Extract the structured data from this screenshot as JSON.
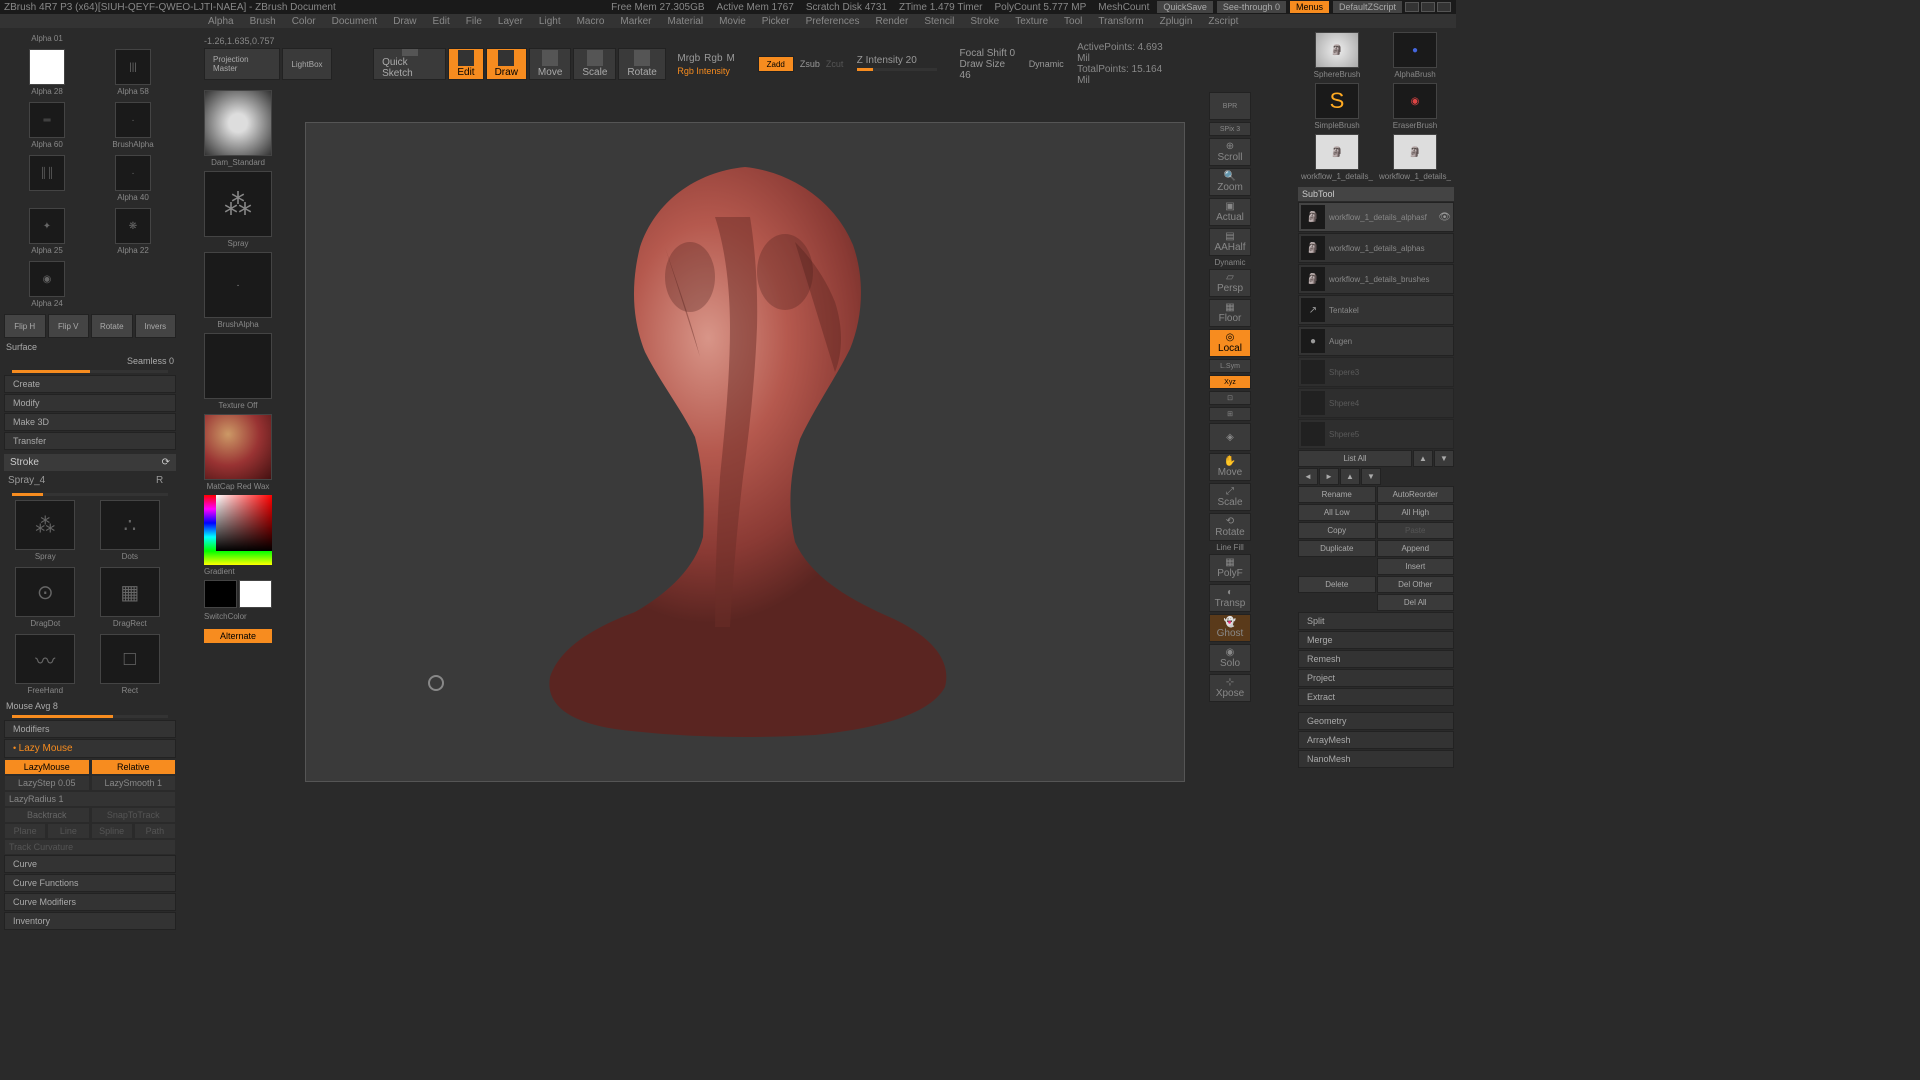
{
  "title": "ZBrush 4R7 P3 (x64)[SIUH-QEYF-QWEO-LJTI-NAEA]  -  ZBrush Document",
  "stats": {
    "freemem": "Free Mem 27.305GB",
    "activemem": "Active Mem 1767",
    "scratch": "Scratch Disk 4731",
    "ztime": "ZTime 1.479 Timer",
    "polycount": "PolyCount 5.777 MP",
    "meshcount": "MeshCount"
  },
  "quicksave": "QuickSave",
  "seethrough": "See-through  0",
  "menus": "Menus",
  "defaultscript": "DefaultZScript",
  "menu": [
    "Alpha",
    "Brush",
    "Color",
    "Document",
    "Draw",
    "Edit",
    "File",
    "Layer",
    "Light",
    "Macro",
    "Marker",
    "Material",
    "Movie",
    "Picker",
    "Preferences",
    "Render",
    "Stencil",
    "Stroke",
    "Texture",
    "Tool",
    "Transform",
    "Zplugin",
    "Zscript"
  ],
  "coords": "-1.26,1.635,0.757",
  "alphas": [
    [
      "Alpha 28",
      "Alpha 58"
    ],
    [
      "Alpha 60",
      "BrushAlpha"
    ],
    [
      "Alpha 25",
      "Alpha 22"
    ],
    [
      "Alpha 24",
      ""
    ]
  ],
  "alpha_top": [
    "Alpha 01",
    ""
  ],
  "alpha40": "Alpha 40",
  "flip": [
    "Flip H",
    "Flip V",
    "Rotate",
    "Invers"
  ],
  "surface": "Surface",
  "seamless": "Seamless 0",
  "create": "Create",
  "modify": "Modify",
  "make3d": "Make 3D",
  "transfer": "Transfer",
  "stroke": "Stroke",
  "spray4": "Spray_4",
  "r": "R",
  "strokes": {
    "spray": "Spray",
    "dots": "Dots",
    "dragrect": "DragRect",
    "dragdot": "DragDot",
    "freehand": "FreeHand",
    "rect": "Rect"
  },
  "mouseavg": "Mouse Avg 8",
  "modifiers": "Modifiers",
  "lazymouse": "Lazy Mouse",
  "lazymouse_btn": "LazyMouse",
  "relative": "Relative",
  "lazystep": "LazyStep 0.05",
  "lazysmooth": "LazySmooth 1",
  "lazyradius": "LazyRadius 1",
  "backtrack": "Backtrack",
  "snaptotrack": "SnapToTrack",
  "plane": "Plane",
  "line": "Line",
  "spline": "Spline",
  "path": "Path",
  "trackcurv": "Track Curvature",
  "curve": "Curve",
  "curvefunc": "Curve Functions",
  "curvemod": "Curve Modifiers",
  "inventory": "Inventory",
  "toolbar": {
    "projmaster": "Projection Master",
    "lightbox": "LightBox",
    "quicksketch": "Quick Sketch",
    "edit": "Edit",
    "draw": "Draw",
    "move": "Move",
    "scale": "Scale",
    "rotate": "Rotate",
    "mrgb": "Mrgb",
    "rgb": "Rgb",
    "m": "M",
    "rgbint": "Rgb Intensity",
    "zadd": "Zadd",
    "zsub": "Zsub",
    "zcut": "Zcut",
    "zint": "Z Intensity 20",
    "focal": "Focal Shift 0",
    "drawsize": "Draw Size 46",
    "dynamic": "Dynamic",
    "activepts": "ActivePoints: 4.693 Mil",
    "totalpts": "TotalPoints: 15.164 Mil"
  },
  "sidestrip": {
    "damstd": "Dam_Standard",
    "spray": "Spray",
    "brushalpha": "BrushAlpha",
    "texoff": "Texture Off",
    "matcap": "MatCap Red Wax",
    "gradient": "Gradient",
    "switchcolor": "SwitchColor",
    "alternate": "Alternate"
  },
  "mini": {
    "bpr": "BPR",
    "spix": "SPix 3",
    "scroll": "Scroll",
    "zoom": "Zoom",
    "actual": "Actual",
    "aahalf": "AAHalf",
    "dynamic": "Dynamic",
    "persp": "Persp",
    "floor": "Floor",
    "local": "Local",
    "lsym": "L.Sym",
    "xyz": "Xyz",
    "frame": "Frame",
    "move": "Move",
    "scale": "Scale",
    "rotate": "Rotate",
    "linefill": "Line Fill",
    "polyf": "PolyF",
    "transp": "Transp",
    "ghost": "Ghost",
    "solo": "Solo",
    "xpose": "Xpose"
  },
  "brushes": [
    [
      "SphereBrush",
      "AlphaBrush"
    ],
    [
      "SimpleBrush",
      "EraserBrush"
    ],
    [
      "workflow_1_details_",
      "workflow_1_details_"
    ]
  ],
  "subtool": "SubTool",
  "subtools": [
    "workflow_1_details_alphasf",
    "workflow_1_details_alphas",
    "workflow_1_details_brushes",
    "Tentakel",
    "Augen",
    "Shpere3",
    "Shpere4",
    "Shpere5"
  ],
  "listall": "List All",
  "actions": {
    "rename": "Rename",
    "autoreorder": "AutoReorder",
    "alllow": "All Low",
    "allhigh": "All High",
    "copy": "Copy",
    "paste": "Paste",
    "duplicate": "Duplicate",
    "append": "Append",
    "insert": "Insert",
    "delete": "Delete",
    "delother": "Del Other",
    "delall": "Del All",
    "split": "Split",
    "merge": "Merge",
    "remesh": "Remesh",
    "project": "Project",
    "extract": "Extract",
    "geometry": "Geometry",
    "arraymesh": "ArrayMesh",
    "nanomesh": "NanoMesh"
  }
}
